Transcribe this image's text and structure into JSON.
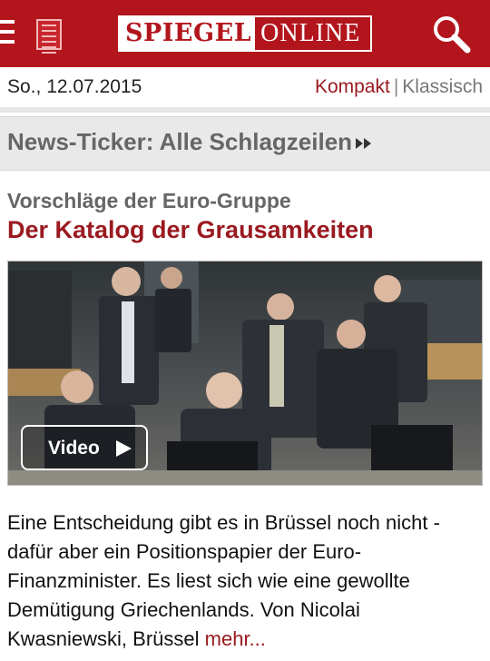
{
  "header": {
    "logo_part1": "SPIEGEL",
    "logo_part2": "ONLINE",
    "brand_color": "#b3151d"
  },
  "topbar": {
    "date": "So., 12.07.2015",
    "mode_compact": "Kompakt",
    "mode_separator": "|",
    "mode_classic": "Klassisch"
  },
  "ticker": {
    "label": "News-Ticker: Alle Schlagzeilen"
  },
  "article": {
    "kicker": "Vorschläge der Euro-Gruppe",
    "headline": "Der Katalog der Grausamkeiten",
    "video_label": "Video",
    "teaser": "Eine Entscheidung gibt es in Brüssel noch nicht - dafür aber ein Positionspapier der Euro-Finanzminister. Es liest sich wie eine gewollte Demütigung Griechenlands. Von Nicolai Kwasniewski, Brüssel",
    "more_label": "mehr..."
  }
}
